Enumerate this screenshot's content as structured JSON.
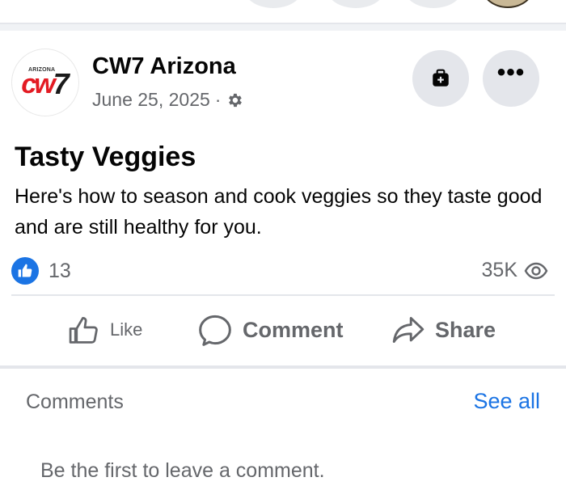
{
  "post": {
    "page_name": "CW7 Arizona",
    "date": "June 25, 2025",
    "separator": "·",
    "logo": {
      "cw": "cw",
      "seven": "7",
      "tiny": "ARIZONA"
    },
    "title": "Tasty Veggies",
    "body": "Here's how to season and cook veggies so they taste good and are still healthy for you.",
    "reaction_count": "13",
    "views": "35K",
    "more_label": "•••"
  },
  "actions": {
    "like": "Like",
    "comment": "Comment",
    "share": "Share"
  },
  "comments": {
    "label": "Comments",
    "see_all": "See all",
    "empty_text": "Be the first to leave a comment."
  },
  "icons": {
    "gear": "gear-icon",
    "save": "briefcase-plus-icon",
    "more": "more-options-icon",
    "like_reaction": "thumbs-up-icon",
    "views": "eye-icon"
  },
  "colors": {
    "accent": "#1b74e4",
    "text_secondary": "#65676b",
    "button_bg": "#e4e6eb",
    "brand_red": "#e31b23"
  }
}
